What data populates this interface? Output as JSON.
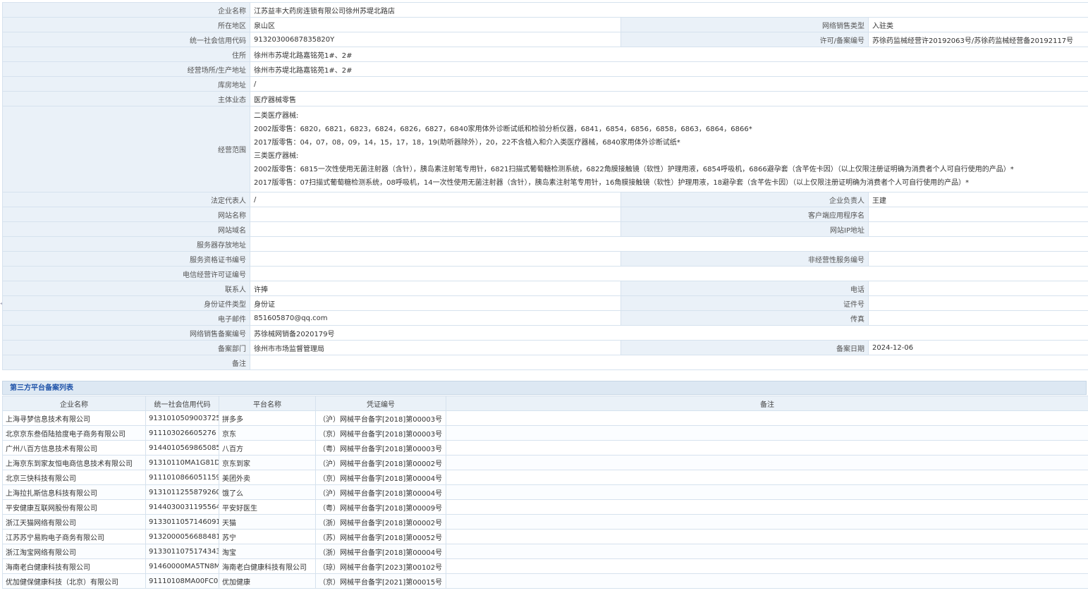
{
  "info": {
    "company_name": {
      "label": "企业名称",
      "value": "江苏益丰大药房连锁有限公司徐州苏堤北路店"
    },
    "region": {
      "label": "所在地区",
      "value": "泉山区"
    },
    "sales_type": {
      "label": "网络销售类型",
      "value": "入驻类"
    },
    "credit_code": {
      "label": "统一社会信用代码",
      "value": "91320300687835820Y"
    },
    "license": {
      "label": "许可/备案编号",
      "value": "苏徐药监械经营许20192063号/苏徐药监械经营备20192117号"
    },
    "residence": {
      "label": "住所",
      "value": "徐州市苏堤北路嘉铭苑1#、2#"
    },
    "business_address": {
      "label": "经营场所/生产地址",
      "value": "徐州市苏堤北路嘉铭苑1#、2#"
    },
    "warehouse": {
      "label": "库房地址",
      "value": "/"
    },
    "main_business": {
      "label": "主体业态",
      "value": "医疗器械零售"
    },
    "scope": {
      "label": "经营范围",
      "lines": [
        "二类医疗器械:",
        "2002版零售：6820，6821，6823，6824，6826，6827，6840家用体外诊断试纸和检验分析仪器，6841，6854，6856，6858，6863，6864，6866*",
        "2017版零售：04，07，08，09，14，15，17，18，19(助听器除外），20，22不含植入和介入类医疗器械，6840家用体外诊断试纸*",
        "三类医疗器械:",
        "2002版零售：6815一次性使用无菌注射器（含针），胰岛素注射笔专用针，6821扫描式葡萄糖检测系统，6822角膜接触镜（软性）护理用液，6854呼吸机，6866避孕套（含芊佐卡因）（以上仅限注册证明确为消费者个人可自行使用的产品）*",
        "2017版零售：07扫描式葡萄糖检测系统，08呼吸机，14一次性使用无菌注射器（含针），胰岛素注射笔专用针，16角膜接触镜（软性）护理用液，18避孕套（含芊佐卡因）（以上仅限注册证明确为消费者个人可自行使用的产品）*"
      ]
    },
    "legal_rep": {
      "label": "法定代表人",
      "value": "/"
    },
    "principal": {
      "label": "企业负责人",
      "value": "王建"
    },
    "website_name": {
      "label": "网站名称",
      "value": ""
    },
    "client_app": {
      "label": "客户端应用程序名",
      "value": ""
    },
    "domain": {
      "label": "网站域名",
      "value": ""
    },
    "ip": {
      "label": "网站IP地址",
      "value": ""
    },
    "server_addr": {
      "label": "服务器存放地址",
      "value": ""
    },
    "service_cert": {
      "label": "服务资格证书编号",
      "value": ""
    },
    "non_op_service": {
      "label": "非经营性服务编号",
      "value": ""
    },
    "telecom_license": {
      "label": "电信经营许可证编号",
      "value": ""
    },
    "contact": {
      "label": "联系人",
      "value": "许捧"
    },
    "phone": {
      "label": "电话",
      "value": ""
    },
    "id_type": {
      "label": "身份证件类型",
      "value": "身份证"
    },
    "id_number": {
      "label": "证件号",
      "value": ""
    },
    "email": {
      "label": "电子邮件",
      "value": "851605870@qq.com"
    },
    "fax": {
      "label": "传真",
      "value": ""
    },
    "filing_number": {
      "label": "网络销售备案编号",
      "value": "苏徐械网销备2020179号"
    },
    "filing_dept": {
      "label": "备案部门",
      "value": "徐州市市场监督管理局"
    },
    "filing_date": {
      "label": "备案日期",
      "value": "2024-12-06"
    },
    "remark": {
      "label": "备注",
      "value": ""
    }
  },
  "platform_section": {
    "title": "第三方平台备案列表",
    "headers": [
      "企业名称",
      "统一社会信用代码",
      "平台名称",
      "凭证编号",
      "备注"
    ],
    "rows": [
      [
        "上海寻梦信息技术有限公司",
        "9131010509003725 2C",
        "拼多多",
        "（沪）网械平台备字[2018]第00003号",
        ""
      ],
      [
        "北京京东叁佰陆拾度电子商务有限公司",
        "911103026605276 5XB",
        "京东",
        "（京）网械平台备字[2018]第00003号",
        ""
      ],
      [
        "广州八百方信息技术有限公司",
        "914401056986508560",
        "八百方",
        "（粤）网械平台备字[2018]第00003号",
        ""
      ],
      [
        "上海京东到家友恒电商信息技术有限公司",
        "91310110MA1G81DR35",
        "京东到家",
        "（沪）网械平台备字[2018]第00002号",
        ""
      ],
      [
        "北京三快科技有限公司",
        "91110108660511594M",
        "美团外卖",
        "（京）网械平台备字[2018]第00004号",
        ""
      ],
      [
        "上海拉扎斯信息科技有限公司",
        "913101125587926096",
        "饿了么",
        "（沪）网械平台备字[2018]第00004号",
        ""
      ],
      [
        "平安健康互联网股份有限公司",
        "91440300311955648R",
        "平安好医生",
        "（粤）网械平台备字[2018]第00009号",
        ""
      ],
      [
        "浙江天猫网络有限公司",
        "91330110571460916M",
        "天猫",
        "（浙）网械平台备字[2018]第00002号",
        ""
      ],
      [
        "江苏苏宁易购电子商务有限公司",
        "913200005668848108",
        "苏宁",
        "（苏）网械平台备字[2018]第00052号",
        ""
      ],
      [
        "浙江淘宝网络有限公司",
        "913301107517434382",
        "淘宝",
        "（浙）网械平台备字[2018]第00004号",
        ""
      ],
      [
        "海南老白健康科技有限公司",
        "91460000MA5TN8MF2D",
        "海南老白健康科技有限公司",
        "（琼）网械平台备字[2023]第00102号",
        ""
      ],
      [
        "优加健保健康科技（北京）有限公司",
        "91110108MA00FC0R25",
        "优加健康",
        "（京）网械平台备字[2021]第00015号",
        ""
      ]
    ]
  }
}
